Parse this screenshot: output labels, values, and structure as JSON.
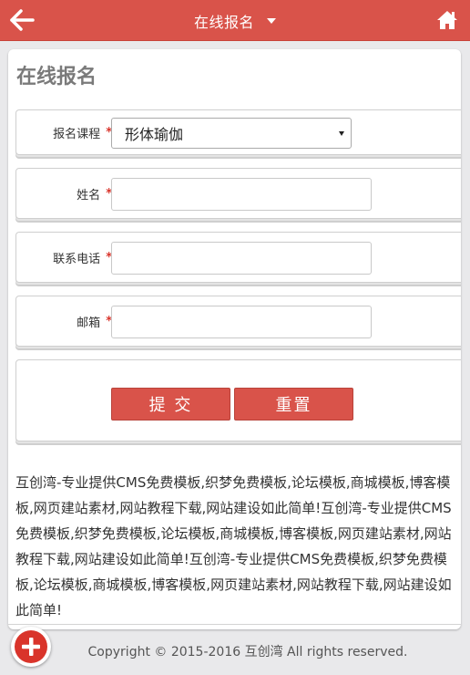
{
  "header": {
    "title": "在线报名"
  },
  "page": {
    "title": "在线报名"
  },
  "form": {
    "course_label": "报名课程",
    "course_value": "形体瑜伽",
    "name_label": "姓名",
    "phone_label": "联系电话",
    "email_label": "邮箱",
    "required_mark": "*",
    "submit_label": "提 交",
    "reset_label": "重置"
  },
  "description": "互创湾-专业提供CMS免费模板,织梦免费模板,论坛模板,商城模板,博客模板,网页建站素材,网站教程下载,网站建设如此简单!互创湾-专业提供CMS免费模板,织梦免费模板,论坛模板,商城模板,博客模板,网页建站素材,网站教程下载,网站建设如此简单!互创湾-专业提供CMS免费模板,织梦免费模板,论坛模板,商城模板,博客模板,网页建站素材,网站教程下载,网站建设如此简单!",
  "footer": {
    "copyright": "Copyright © 2015-2016 互创湾 All rights reserved."
  },
  "colors": {
    "accent": "#d9534a",
    "required": "#d9342b"
  },
  "icons": {
    "back": "arrow-left-icon",
    "home": "home-icon",
    "dropdown": "caret-down-icon",
    "fab": "plus-icon"
  }
}
